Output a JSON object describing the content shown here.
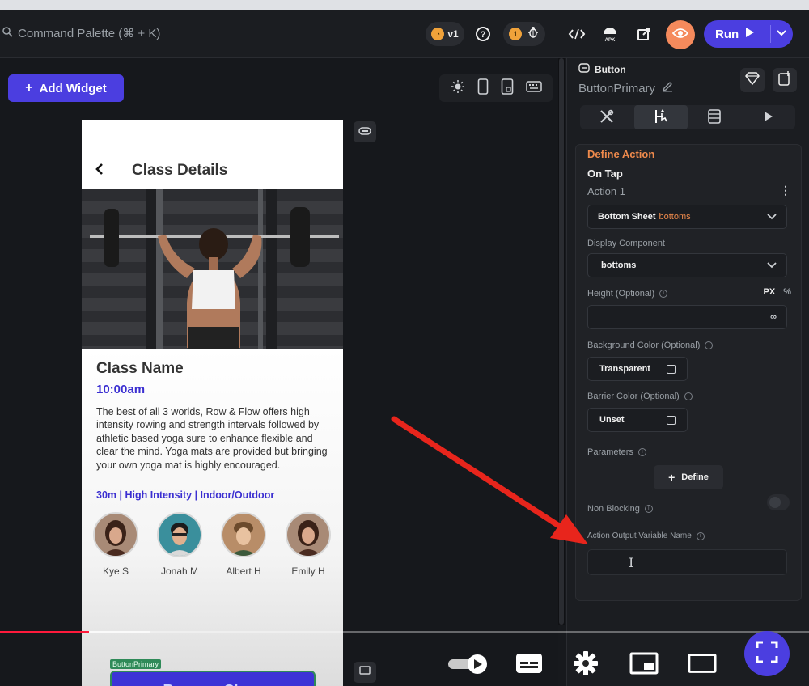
{
  "topbar": {
    "command_palette": "Command Palette (⌘ + K)",
    "version_badge": "v1",
    "bug_count": "1",
    "run_label": "Run"
  },
  "canvas": {
    "add_widget_label": "Add Widget"
  },
  "phone": {
    "title": "Class Details",
    "class_name": "Class Name",
    "class_time": "10:00am",
    "description": "The best of all 3 worlds, Row & Flow offers high intensity rowing and strength intervals followed by athletic based yoga sure to enhance flexible and clear the mind. Yoga mats are provided but bringing your own yoga mat is highly encouraged.",
    "tags": "30m | High Intensity | Indoor/Outdoor",
    "attendees": [
      {
        "name": "Kye S"
      },
      {
        "name": "Jonah M"
      },
      {
        "name": "Albert H"
      },
      {
        "name": "Emily H"
      }
    ],
    "widget_tag": "ButtonPrimary",
    "button_label": "Rename Class"
  },
  "panel": {
    "widget_type": "Button",
    "widget_name": "ButtonPrimary",
    "define_action_title": "Define Action",
    "trigger": "On Tap",
    "action_label": "Action 1",
    "action_type": "Bottom Sheet",
    "action_type_suffix": "bottoms",
    "display_component_label": "Display Component",
    "display_component_value": "bottoms",
    "height_label": "Height (Optional)",
    "height_unit_px": "PX",
    "height_unit_pct": "%",
    "height_value": "∞",
    "bg_color_label": "Background Color (Optional)",
    "bg_color_value": "Transparent",
    "barrier_color_label": "Barrier Color (Optional)",
    "barrier_color_value": "Unset",
    "parameters_label": "Parameters",
    "define_label": "Define",
    "non_blocking_label": "Non Blocking",
    "output_var_label": "Action Output Variable Name",
    "output_var_value": ""
  },
  "player": {
    "progress": 0.11,
    "buffered": 0.185
  },
  "colors": {
    "accent": "#4b3ee0",
    "orange": "#ee8a4c",
    "annotation_red": "#e8251c",
    "progress_red": "#ff1a3c"
  }
}
